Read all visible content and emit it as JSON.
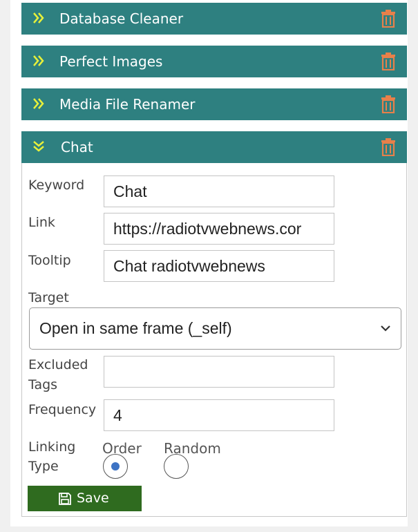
{
  "colors": {
    "header_bg": "#2e8080",
    "chevron": "#e7f03a",
    "trash": "#e8804a",
    "save_bg": "#2f6b1f",
    "radio_selected": "#3d73c4"
  },
  "sections": [
    {
      "title": "Database Cleaner",
      "expanded": false
    },
    {
      "title": "Perfect Images",
      "expanded": false
    },
    {
      "title": "Media File Renamer",
      "expanded": false
    },
    {
      "title": "Chat",
      "expanded": true
    }
  ],
  "form": {
    "keyword": {
      "label": "Keyword",
      "value": "Chat"
    },
    "link": {
      "label": "Link",
      "value": "https://radiotvwebnews.cor"
    },
    "tooltip": {
      "label": "Tooltip",
      "value": "Chat radiotvwebnews"
    },
    "target": {
      "label": "Target",
      "selected": "Open in same frame (_self)"
    },
    "excluded_tags": {
      "label_line1": "Excluded",
      "label_line2": "Tags",
      "value": ""
    },
    "frequency": {
      "label": "Frequency",
      "value": "4"
    },
    "linking_type": {
      "label_line1": "Linking",
      "label_line2": "Type",
      "options": [
        {
          "label": "Order",
          "selected": true
        },
        {
          "label": "Random",
          "selected": false
        }
      ]
    },
    "save_label": "Save"
  }
}
